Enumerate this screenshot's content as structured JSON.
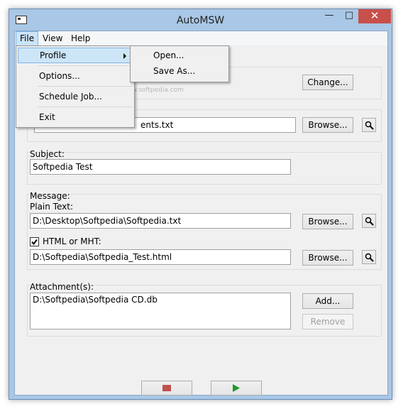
{
  "window": {
    "title": "AutoMSW"
  },
  "menubar": {
    "file": "File",
    "view": "View",
    "help": "Help"
  },
  "file_menu": {
    "profile": "Profile",
    "options": "Options...",
    "schedule": "Schedule Job...",
    "exit": "Exit"
  },
  "profile_submenu": {
    "open": "Open...",
    "save_as": "Save As..."
  },
  "sender": {
    "change_label": "Change..."
  },
  "recipients": {
    "value_partial": "ents.txt",
    "browse_label": "Browse..."
  },
  "subject": {
    "label": "Subject:",
    "value": "Softpedia Test"
  },
  "message": {
    "label": "Message:",
    "plain_label": "Plain Text:",
    "plain_value": "D:\\Desktop\\Softpedia\\Softpedia.txt",
    "html_label": "HTML or MHT:",
    "html_checked": true,
    "html_value": "D:\\Softpedia\\Softpedia_Test.html",
    "browse_label": "Browse..."
  },
  "attachments": {
    "label": "Attachment(s):",
    "items": [
      "D:\\Softpedia\\Softpedia CD.db"
    ],
    "add_label": "Add...",
    "remove_label": "Remove"
  },
  "watermark": {
    "text": "SOFTPEDIA",
    "url": "www.softpedia.com"
  },
  "colors": {
    "stop": "#c0504d",
    "play": "#1f9a2c",
    "close": "#c7504b"
  }
}
